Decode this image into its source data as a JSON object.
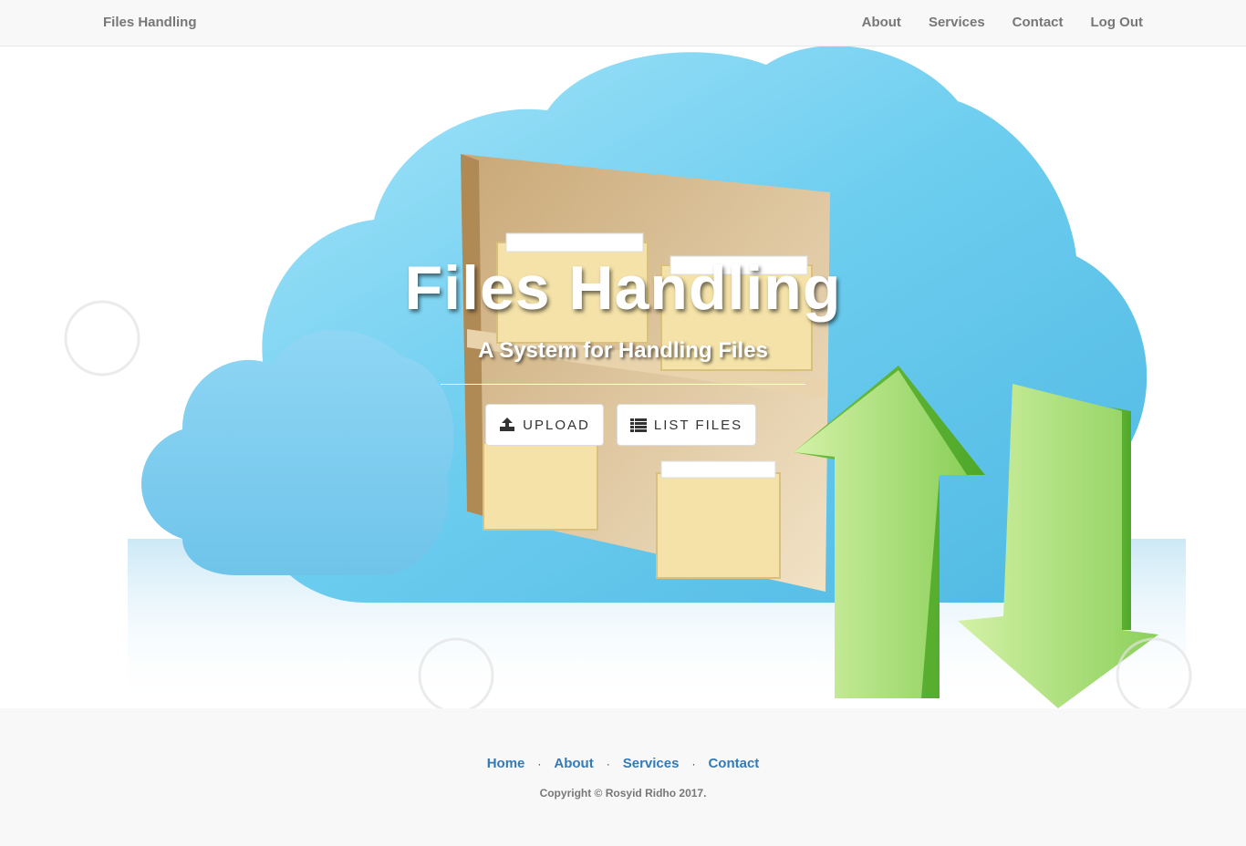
{
  "navbar": {
    "brand": "Files Handling",
    "links": [
      "About",
      "Services",
      "Contact",
      "Log Out"
    ]
  },
  "hero": {
    "title": "Files Handling",
    "subtitle": "A System for Handling Files",
    "buttons": {
      "upload": {
        "label": "UPLOAD",
        "icon": "upload-icon"
      },
      "list_files": {
        "label": "LIST FILES",
        "icon": "list-icon"
      }
    },
    "background_image": "cloud-folders-arrows-illustration"
  },
  "footer": {
    "links": [
      "Home",
      "About",
      "Services",
      "Contact"
    ],
    "separator": "·",
    "copyright": "Copyright © Rosyid Ridho 2017."
  },
  "colors": {
    "navbar_bg": "#f8f8f8",
    "nav_text": "#777777",
    "footer_link": "#337ab7",
    "cloud_blue": "#5cc3ea",
    "arrow_green": "#8dd35f"
  }
}
